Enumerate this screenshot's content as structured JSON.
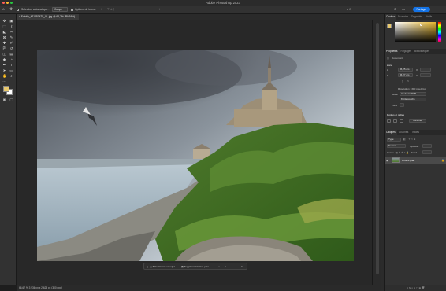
{
  "app": {
    "title": "Adobe Photoshop 2023"
  },
  "options_bar": {
    "auto_select_label": "Sélection automatique :",
    "auto_select_value": "Calque",
    "transform_label": "Options de transf.",
    "share_label": "Partager"
  },
  "document": {
    "tab_label": "Fotolia_421457475_XL.jpg @ 66,7% (RVB/8#)",
    "status_text": "66,67 %   3 936 px x 2 623 px (300 ppp)"
  },
  "contextual_bar": {
    "remove_bg_label": "Sélectionner un sujet",
    "remove_bg2_label": "Supprimer l'arrière-plan"
  },
  "panels": {
    "top_tabs": [
      "Couleur",
      "Nuancier",
      "Dégradés",
      "Motifs"
    ],
    "properties_tabs": [
      "Propriétés",
      "Réglages",
      "Bibliothèques"
    ],
    "properties": {
      "doc_label": "Document",
      "canvas_section": "Zone",
      "width_value": "36,25 cm",
      "height_value": "36,27 cm",
      "x_label": "X",
      "y_label": "Y",
      "resolution_text": "Résolution : 300 pixels/po",
      "mode_label": "Mode",
      "mode_value": "Couleurs RVB",
      "depth_value": "8 bits/couche",
      "fill_label": "Fond",
      "guides_section": "Règles et grilles",
      "canvas_btn": "Canevas"
    },
    "layers_tabs": [
      "Calques",
      "Couches",
      "Tracés"
    ],
    "layers": {
      "kind_label": "Type",
      "mode_value": "Normal",
      "opacity_label": "Opacité :",
      "lock_label": "Verrou :",
      "fill_label": "Fond :",
      "items": [
        {
          "name": "Arrière-plan"
        }
      ]
    }
  },
  "colors": {
    "accent": "#1473e6",
    "foreground": "#e8c86c",
    "background": "#ffffff"
  },
  "icons": {
    "tools": [
      "move-icon",
      "artboard-icon",
      "marquee-icon",
      "lasso-icon",
      "object-select-icon",
      "crop-icon",
      "frame-icon",
      "eyedropper-icon",
      "healing-icon",
      "brush-icon",
      "clone-icon",
      "history-brush-icon",
      "eraser-icon",
      "gradient-icon",
      "blur-icon",
      "dodge-icon",
      "pen-icon",
      "type-icon",
      "path-select-icon",
      "shape-icon",
      "hand-icon",
      "zoom-icon",
      "more-icon"
    ]
  }
}
